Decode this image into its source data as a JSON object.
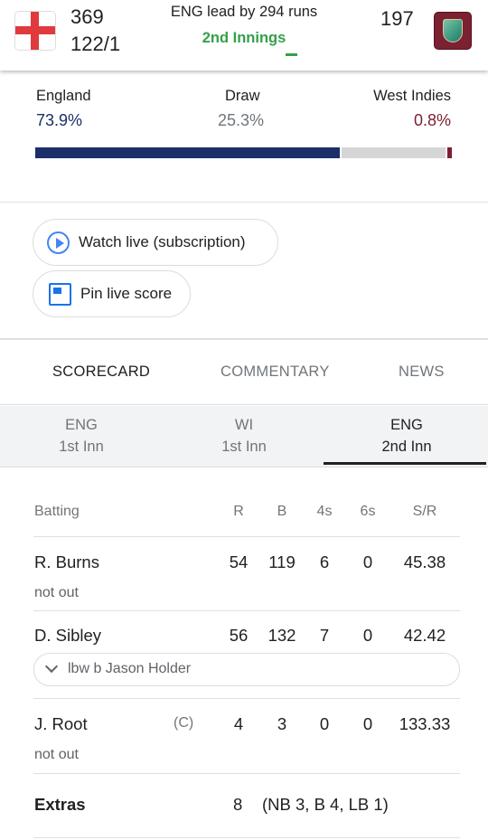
{
  "header": {
    "home_team_flag": "england-flag-icon",
    "home_score_first": "369",
    "home_score_second": "122/1",
    "status": "ENG lead by 294 runs",
    "innings": "2nd Innings",
    "away_score": "197",
    "away_team_flag": "west-indies-flag-icon"
  },
  "win_probability": {
    "home": {
      "label": "England",
      "value": "73.9%",
      "fraction": 0.739,
      "color": "#1c2f68"
    },
    "draw": {
      "label": "Draw",
      "value": "25.3%",
      "fraction": 0.253,
      "color": "#d6d6d6"
    },
    "away": {
      "label": "West Indies",
      "value": "0.8%",
      "fraction": 0.008,
      "color": "#7b2131"
    }
  },
  "actions": {
    "watch_live": "Watch live (subscription)",
    "pin_score": "Pin live score"
  },
  "tabs": {
    "scorecard": "SCORECARD",
    "commentary": "COMMENTARY",
    "news": "NEWS",
    "active": "SCORECARD"
  },
  "innings_tabs": [
    {
      "team": "ENG",
      "inn": "1st Inn"
    },
    {
      "team": "WI",
      "inn": "1st Inn"
    },
    {
      "team": "ENG",
      "inn": "2nd Inn",
      "active": true
    }
  ],
  "batting": {
    "headers": {
      "batting": "Batting",
      "r": "R",
      "b": "B",
      "fours": "4s",
      "sixes": "6s",
      "sr": "S/R"
    },
    "rows": [
      {
        "name": "R. Burns",
        "r": "54",
        "b": "119",
        "fours": "6",
        "sixes": "0",
        "sr": "45.38",
        "status": "not out"
      },
      {
        "name": "D. Sibley",
        "r": "56",
        "b": "132",
        "fours": "7",
        "sixes": "0",
        "sr": "42.42",
        "dismissal": "lbw b Jason Holder"
      },
      {
        "name": "J. Root",
        "captain": "(C)",
        "r": "4",
        "b": "3",
        "fours": "0",
        "sixes": "0",
        "sr": "133.33",
        "status": "not out"
      }
    ],
    "extras": {
      "label": "Extras",
      "total": "8",
      "detail": "(NB 3, B 4, LB 1)"
    }
  },
  "colors": {
    "accent_green": "#34a04a",
    "england_navy": "#1c2f68",
    "west_indies_maroon": "#7b2131"
  }
}
